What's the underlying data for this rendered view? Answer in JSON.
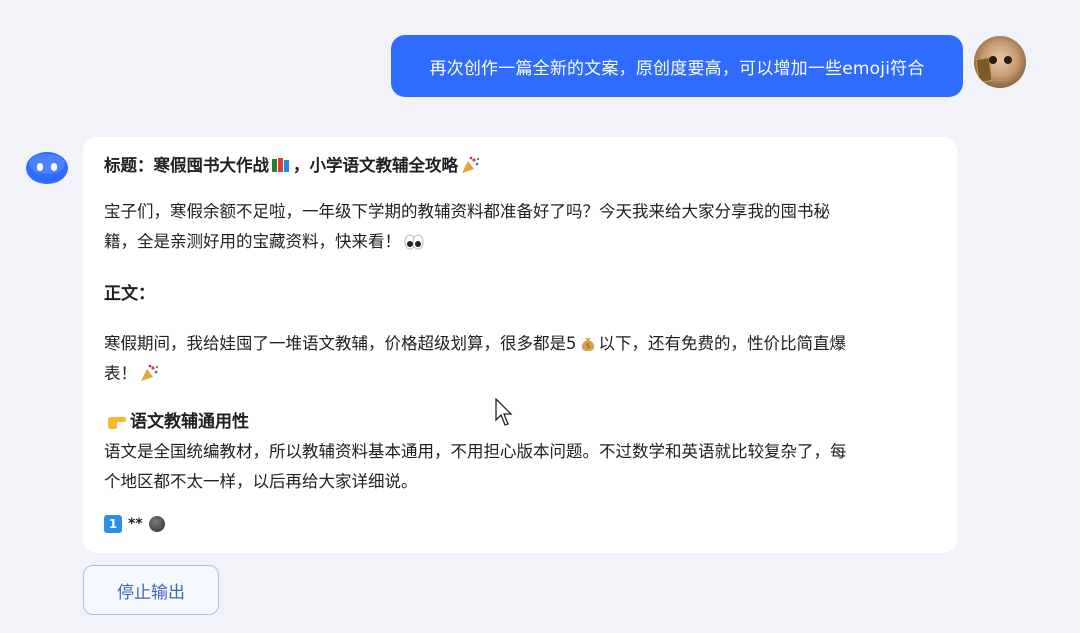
{
  "user_message": {
    "text": "再次创作一篇全新的文案，原创度要高，可以增加一些emoji符合"
  },
  "assistant_message": {
    "title_line": "标题：寒假囤书大作战",
    "title_tail": "，小学语文教辅全攻略",
    "intro_line1": "宝子们，寒假余额不足啦，一年级下学期的教辅资料都准备好了吗？今天我来给大家分享我的囤书秘",
    "intro_line2": "籍，全是亲测好用的宝藏资料，快来看！",
    "body_heading": "正文：",
    "body_line1_a": "寒假期间，我给娃囤了一堆语文教辅，价格超级划算，很多都是5",
    "body_line1_b": "以下，还有免费的，性价比简直爆",
    "body_line2": "表！",
    "section_heading": "语文教辅通用性",
    "section_line1": "语文是全国统编教材，所以教辅资料基本通用，不用担心版本问题。不过数学和英语就比较复杂了，每",
    "section_line2": "个地区都不太一样，以后再给大家详细说。",
    "keycap_label": "1",
    "partial_text": "**"
  },
  "icons": {
    "books": "books-emoji",
    "party": "party-popper-emoji",
    "eyes": "eyes-emoji",
    "money_bag": "money-bag-emoji",
    "pointing": "backhand-index-pointing-right-emoji",
    "keycap": "keycap-1-emoji",
    "loading": "loading-dot"
  },
  "controls": {
    "stop_label": "停止输出"
  },
  "colors": {
    "user_bubble": "#2f6bff",
    "background": "#f1f3f8",
    "card": "#ffffff",
    "stop_border": "#a9c0ea",
    "stop_text": "#3f67b8",
    "bot_avatar": "#2f6bff"
  }
}
